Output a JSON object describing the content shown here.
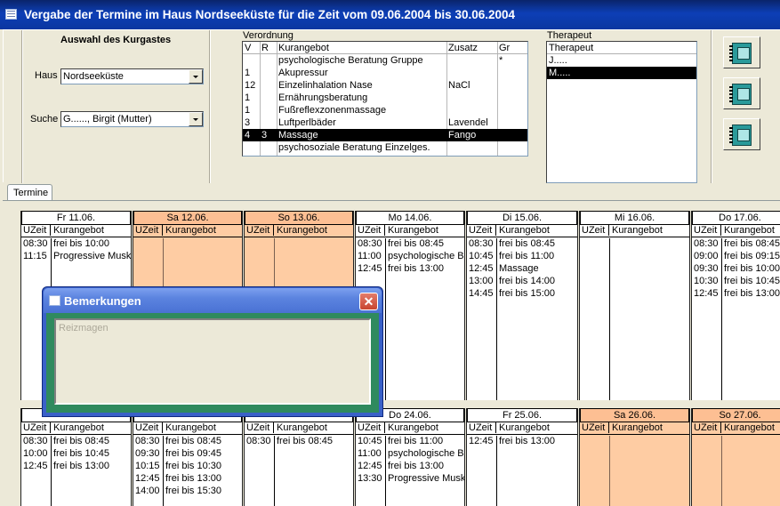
{
  "window": {
    "title": "Vergabe der Termine im Haus Nordseeküste für die Zeit vom 09.06.2004 bis 30.06.2004"
  },
  "guest": {
    "section_title": "Auswahl des Kurgastes",
    "haus_label": "Haus",
    "haus_value": "Nordseeküste",
    "suche_label": "Suche",
    "suche_value": "G......, Birgit (Mutter)"
  },
  "verordnung": {
    "label": "Verordnung",
    "headers": {
      "v": "V",
      "r": "R",
      "kurangebot": "Kurangebot",
      "zusatz": "Zusatz",
      "gr": "Gr"
    },
    "rows": [
      {
        "v": "",
        "r": "",
        "kurangebot": "psychologische Beratung Gruppe",
        "zusatz": "",
        "gr": "*",
        "selected": false
      },
      {
        "v": "1",
        "r": "",
        "kurangebot": "Akupressur",
        "zusatz": "",
        "gr": "",
        "selected": false
      },
      {
        "v": "12",
        "r": "",
        "kurangebot": "Einzelinhalation Nase",
        "zusatz": "NaCl",
        "gr": "",
        "selected": false
      },
      {
        "v": "1",
        "r": "",
        "kurangebot": "Ernährungsberatung",
        "zusatz": "",
        "gr": "",
        "selected": false
      },
      {
        "v": "1",
        "r": "",
        "kurangebot": "Fußreflexzonenmassage",
        "zusatz": "",
        "gr": "",
        "selected": false
      },
      {
        "v": "3",
        "r": "",
        "kurangebot": "Luftperlbäder",
        "zusatz": "Lavendel",
        "gr": "",
        "selected": false
      },
      {
        "v": "4",
        "r": "3",
        "kurangebot": "Massage",
        "zusatz": "Fango",
        "gr": "",
        "selected": true
      },
      {
        "v": "",
        "r": "",
        "kurangebot": "psychosoziale Beratung Einzelges.",
        "zusatz": "",
        "gr": "",
        "selected": false
      }
    ]
  },
  "therapeut": {
    "label": "Therapeut",
    "header": "Therapeut",
    "items": [
      {
        "name": "J.....",
        "selected": false
      },
      {
        "name": "M.....",
        "selected": true
      }
    ]
  },
  "actions": [
    "notebook-icon",
    "notebook-icon",
    "notebook-icon"
  ],
  "tabs": {
    "termine": "Termine"
  },
  "columns": {
    "uzeit": "UZeit",
    "kurangebot": "Kurangebot"
  },
  "week1": [
    {
      "header": "Fr  11.06.",
      "weekend": false,
      "entries": [
        {
          "t": "08:30",
          "a": "frei bis 10:00"
        },
        {
          "t": "11:15",
          "a": "Progressive Musk"
        }
      ]
    },
    {
      "header": "Sa  12.06.",
      "weekend": true,
      "entries": []
    },
    {
      "header": "So  13.06.",
      "weekend": true,
      "entries": []
    },
    {
      "header": "Mo  14.06.",
      "weekend": false,
      "entries": [
        {
          "t": "08:30",
          "a": "frei bis 08:45"
        },
        {
          "t": "11:00",
          "a": "psychologische B"
        },
        {
          "t": "12:45",
          "a": "frei bis 13:00"
        }
      ]
    },
    {
      "header": "Di  15.06.",
      "weekend": false,
      "entries": [
        {
          "t": "08:30",
          "a": "frei bis 08:45"
        },
        {
          "t": "10:45",
          "a": "frei bis 11:00"
        },
        {
          "t": "12:45",
          "a": "Massage"
        },
        {
          "t": "13:00",
          "a": "frei bis 14:00"
        },
        {
          "t": "14:45",
          "a": "frei bis 15:00"
        }
      ]
    },
    {
      "header": "Mi  16.06.",
      "weekend": false,
      "entries": []
    },
    {
      "header": "Do  17.06.",
      "weekend": false,
      "entries": [
        {
          "t": "08:30",
          "a": "frei bis 08:45"
        },
        {
          "t": "09:00",
          "a": "frei bis 09:15"
        },
        {
          "t": "09:30",
          "a": "frei bis 10:00"
        },
        {
          "t": "10:30",
          "a": "frei bis 10:45"
        },
        {
          "t": "12:45",
          "a": "frei bis 13:00"
        }
      ]
    }
  ],
  "week2": [
    {
      "header": "",
      "weekend": false,
      "entries": [
        {
          "t": "08:30",
          "a": "frei bis 08:45"
        },
        {
          "t": "10:00",
          "a": "frei bis 10:45"
        },
        {
          "t": "12:45",
          "a": "frei bis 13:00"
        }
      ]
    },
    {
      "header": "",
      "weekend": false,
      "entries": [
        {
          "t": "08:30",
          "a": "frei bis 08:45"
        },
        {
          "t": "09:30",
          "a": "frei bis 09:45"
        },
        {
          "t": "10:15",
          "a": "frei bis 10:30"
        },
        {
          "t": "12:45",
          "a": "frei bis 13:00"
        },
        {
          "t": "14:00",
          "a": "frei bis 15:30"
        }
      ]
    },
    {
      "header": "",
      "weekend": false,
      "entries": [
        {
          "t": "08:30",
          "a": "frei bis 08:45"
        }
      ]
    },
    {
      "header": "Do  24.06.",
      "weekend": false,
      "entries": [
        {
          "t": "10:45",
          "a": "frei bis 11:00"
        },
        {
          "t": "11:00",
          "a": "psychologische B"
        },
        {
          "t": "12:45",
          "a": "frei bis 13:00"
        },
        {
          "t": "13:30",
          "a": "Progressive Musk"
        }
      ]
    },
    {
      "header": "Fr  25.06.",
      "weekend": false,
      "entries": [
        {
          "t": "12:45",
          "a": "frei bis 13:00"
        }
      ]
    },
    {
      "header": "Sa  26.06.",
      "weekend": true,
      "entries": []
    },
    {
      "header": "So  27.06.",
      "weekend": true,
      "entries": []
    }
  ],
  "dialog": {
    "title": "Bemerkungen",
    "memo_label": "Reizmagen"
  }
}
